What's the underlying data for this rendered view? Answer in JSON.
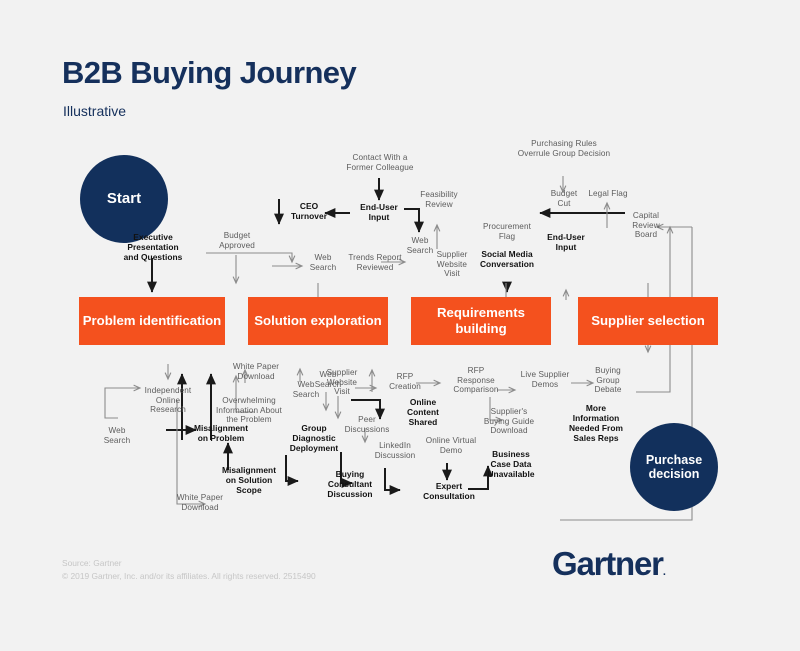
{
  "header": {
    "title": "B2B Buying Journey",
    "subtitle": "Illustrative"
  },
  "colors": {
    "background": "#f2f2f2",
    "navy": "#12305c",
    "orange": "#f4511e",
    "label_gray": "#5c5c5c",
    "label_bold": "#111111",
    "footer_gray": "#c6c6c6",
    "connector_gray": "#8c8c8c",
    "connector_black": "#1a1a1a"
  },
  "endpoints": {
    "start": "Start",
    "purchase": "Purchase\ndecision"
  },
  "stages": [
    {
      "id": "problem",
      "label": "Problem\nidentification"
    },
    {
      "id": "solution",
      "label": "Solution\nexploration"
    },
    {
      "id": "requirements",
      "label": "Requirements\nbuilding"
    },
    {
      "id": "supplier",
      "label": "Supplier\nselection"
    }
  ],
  "nodes_top": [
    {
      "id": "exec-presentation",
      "label": "Executive\nPresentation\nand Questions",
      "bold": true
    },
    {
      "id": "ceo-turnover",
      "label": "CEO\nTurnover",
      "bold": true
    },
    {
      "id": "budget-approved",
      "label": "Budget\nApproved",
      "bold": false
    },
    {
      "id": "web-search-solution",
      "label": "Web\nSearch",
      "bold": false
    },
    {
      "id": "contact-former-colleague",
      "label": "Contact With a\nFormer Colleague",
      "bold": false
    },
    {
      "id": "end-user-input-left",
      "label": "End-User\nInput",
      "bold": true
    },
    {
      "id": "trends-report",
      "label": "Trends Report\nReviewed",
      "bold": false
    },
    {
      "id": "feasibility-review",
      "label": "Feasibility\nReview",
      "bold": false
    },
    {
      "id": "web-search-feasibility",
      "label": "Web\nSearch",
      "bold": false
    },
    {
      "id": "supplier-website-visit-top",
      "label": "Supplier\nWebsite\nVisit",
      "bold": false
    },
    {
      "id": "procurement-flag",
      "label": "Procurement\nFlag",
      "bold": false
    },
    {
      "id": "social-media",
      "label": "Social Media\nConversation",
      "bold": true
    },
    {
      "id": "purchasing-rules",
      "label": "Purchasing Rules\nOverrule Group Decision",
      "bold": false
    },
    {
      "id": "budget-cut",
      "label": "Budget\nCut",
      "bold": false
    },
    {
      "id": "end-user-input-right",
      "label": "End-User\nInput",
      "bold": true
    },
    {
      "id": "legal-flag",
      "label": "Legal Flag",
      "bold": false
    },
    {
      "id": "capital-review-board",
      "label": "Capital\nReview\nBoard",
      "bold": false
    }
  ],
  "nodes_bottom": [
    {
      "id": "web-search-left",
      "label": "Web\nSearch",
      "bold": false
    },
    {
      "id": "independent-research",
      "label": "Independent\nOnline\nResearch",
      "bold": false
    },
    {
      "id": "white-paper-download-left",
      "label": "White Paper\nDownload",
      "bold": false
    },
    {
      "id": "misalignment-problem",
      "label": "Misalignment\non Problem",
      "bold": true
    },
    {
      "id": "misalignment-scope",
      "label": "Misalignment\non Solution\nScope",
      "bold": true
    },
    {
      "id": "overwhelming-info",
      "label": "Overwhelming\nInformation About\nthe Problem",
      "bold": false
    },
    {
      "id": "white-paper-download-top",
      "label": "White Paper\nDownload",
      "bold": false
    },
    {
      "id": "web-search-mid",
      "label": "Web\nSearch",
      "bold": false
    },
    {
      "id": "web-search-group",
      "label": "Web\nSearch",
      "bold": false
    },
    {
      "id": "group-diagnostic",
      "label": "Group\nDiagnostic\nDeployment",
      "bold": true
    },
    {
      "id": "buying-consultant",
      "label": "Buying\nConsultant\nDiscussion",
      "bold": true
    },
    {
      "id": "supplier-website-visit",
      "label": "Supplier\nWebsite\nVisit",
      "bold": false
    },
    {
      "id": "peer-discussions",
      "label": "Peer\nDiscussions",
      "bold": false
    },
    {
      "id": "linkedin-discussion",
      "label": "LinkedIn\nDiscussion",
      "bold": false
    },
    {
      "id": "rfp-creation",
      "label": "RFP\nCreation",
      "bold": false
    },
    {
      "id": "online-content-shared",
      "label": "Online\nContent\nShared",
      "bold": true
    },
    {
      "id": "rfp-response",
      "label": "RFP\nResponse\nComparison",
      "bold": false
    },
    {
      "id": "online-virtual-demo",
      "label": "Online Virtual\nDemo",
      "bold": false
    },
    {
      "id": "expert-consultation",
      "label": "Expert\nConsultation",
      "bold": true
    },
    {
      "id": "suppliers-buying-guide",
      "label": "Supplier's\nBuying Guide\nDownload",
      "bold": false
    },
    {
      "id": "business-case-data",
      "label": "Business\nCase Data\nUnavailable",
      "bold": true
    },
    {
      "id": "live-supplier-demos",
      "label": "Live Supplier\nDemos",
      "bold": false
    },
    {
      "id": "buying-group-debate",
      "label": "Buying\nGroup\nDebate",
      "bold": false
    },
    {
      "id": "more-information",
      "label": "More\nInformation\nNeeded From\nSales Reps",
      "bold": true
    }
  ],
  "footer": {
    "source": "Source: Gartner",
    "copyright": "© 2019 Gartner, Inc. and/or its affiliates. All rights reserved. 2515490"
  },
  "logo": {
    "text": "Gartner",
    "mark": "."
  }
}
